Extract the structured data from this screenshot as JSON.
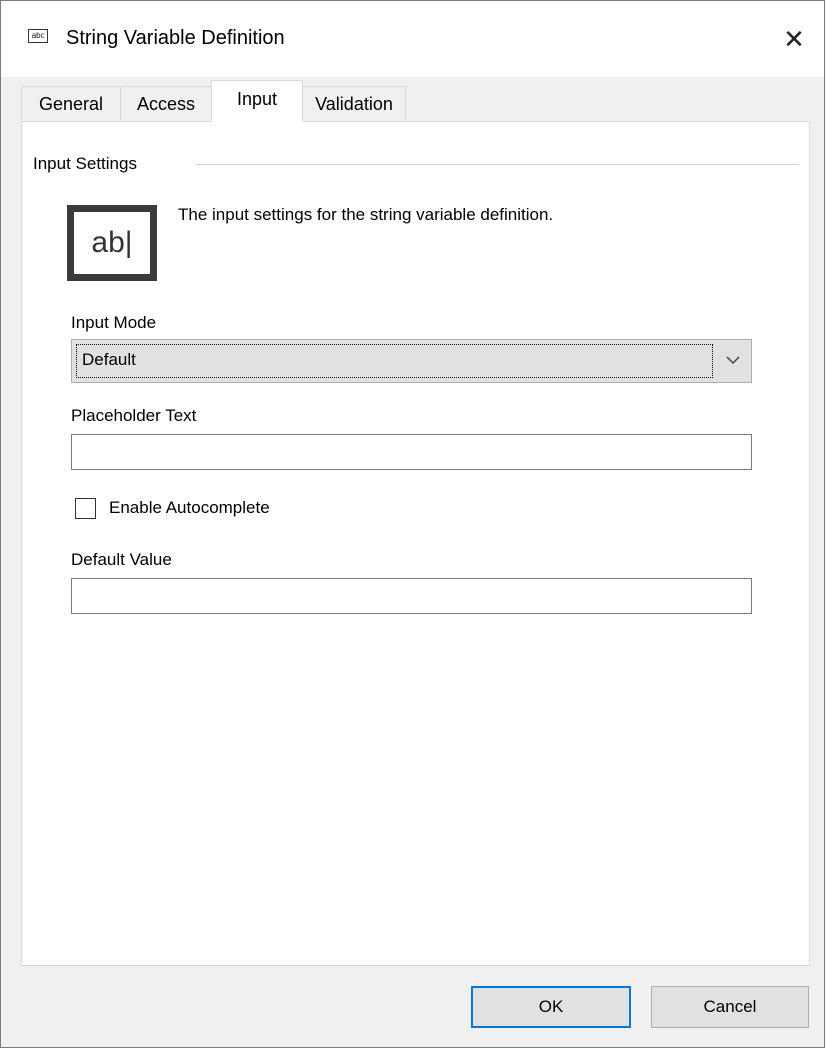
{
  "window": {
    "title": "String Variable Definition",
    "title_icon_text": "abc",
    "close_glyph": "✕"
  },
  "tabs": [
    {
      "label": "General",
      "active": false
    },
    {
      "label": "Access",
      "active": false
    },
    {
      "label": "Input",
      "active": true
    },
    {
      "label": "Validation",
      "active": false
    }
  ],
  "group": {
    "label": "Input Settings",
    "icon_text": "ab|",
    "description": "The input settings for the string variable definition."
  },
  "input_mode": {
    "label": "Input Mode",
    "value": "Default"
  },
  "placeholder_text": {
    "label": "Placeholder Text",
    "value": ""
  },
  "autocomplete": {
    "label": "Enable Autocomplete",
    "checked": false
  },
  "default_value": {
    "label": "Default Value",
    "value": ""
  },
  "buttons": {
    "ok": "OK",
    "cancel": "Cancel"
  },
  "colors": {
    "accent": "#0078d7",
    "dialog_bg": "#f0f0f0",
    "panel_bg": "#ffffff"
  }
}
